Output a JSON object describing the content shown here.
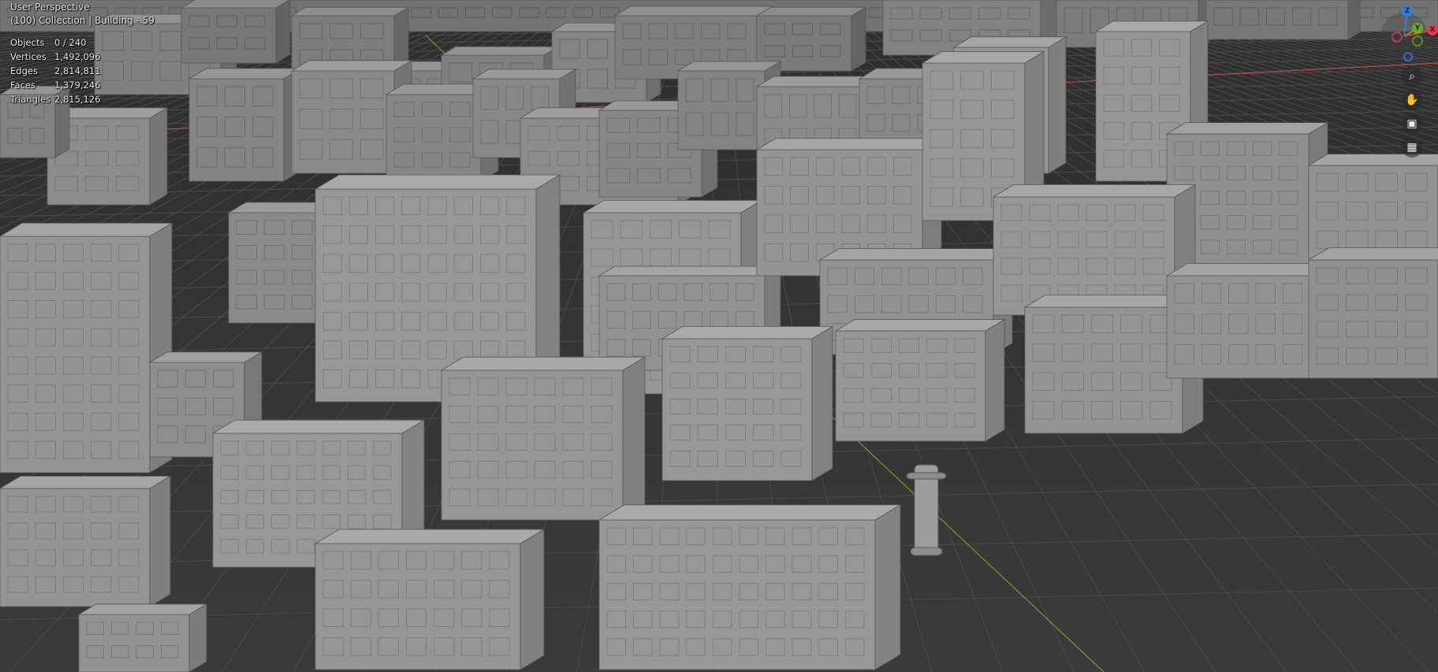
{
  "viewport": {
    "view_title": "User Perspective",
    "collection_label": "(100) Collection | Building - 59",
    "stats": [
      {
        "label": "Objects",
        "value": "0 / 240"
      },
      {
        "label": "Vertices",
        "value": "1,492,096"
      },
      {
        "label": "Edges",
        "value": "2,814,811"
      },
      {
        "label": "Faces",
        "value": "1,379,246"
      },
      {
        "label": "Triangles",
        "value": "2,815,126"
      }
    ]
  },
  "gizmo": {
    "axes": [
      {
        "label": "Z",
        "color": "#2f7fe0"
      },
      {
        "label": "Y",
        "color": "#6fa821"
      },
      {
        "label": "X",
        "color": "#e0394f"
      }
    ]
  },
  "nav_buttons": [
    {
      "name": "zoom-icon",
      "glyph": "⌕"
    },
    {
      "name": "pan-hand-icon",
      "glyph": "✋"
    },
    {
      "name": "camera-icon",
      "glyph": "▣"
    },
    {
      "name": "perspective-grid-icon",
      "glyph": "▦"
    }
  ],
  "colors": {
    "background": "#393939",
    "building": "#8e8e8e",
    "x_axis_line": "#b84d4d",
    "y_axis_line": "#7a9a2a"
  }
}
